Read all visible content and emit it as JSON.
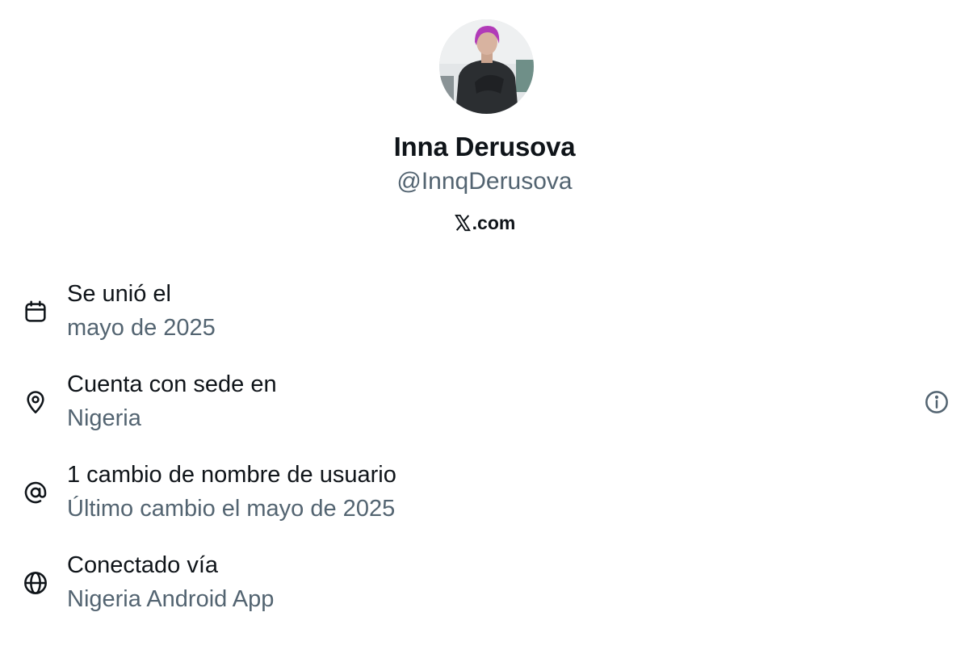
{
  "profile": {
    "display_name": "Inna Derusova",
    "handle": "@InnqDerusova",
    "domain_suffix": ".com"
  },
  "details": [
    {
      "icon": "calendar-icon",
      "title": "Se unió el",
      "value": "mayo de 2025"
    },
    {
      "icon": "location-pin-icon",
      "title": "Cuenta con sede en",
      "value": "Nigeria"
    },
    {
      "icon": "at-sign-icon",
      "title": "1 cambio de nombre de usuario",
      "value": "Último cambio el mayo de 2025"
    },
    {
      "icon": "globe-icon",
      "title": "Conectado vía",
      "value": "Nigeria Android App"
    }
  ],
  "colors": {
    "text_primary": "#0f1419",
    "text_secondary": "#536471"
  }
}
